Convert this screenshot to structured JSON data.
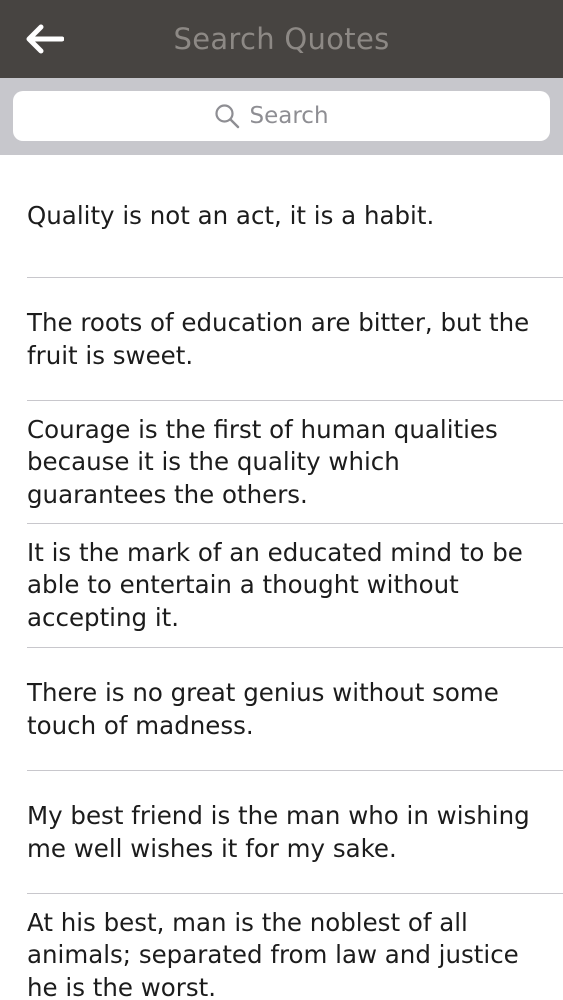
{
  "header": {
    "title": "Search Quotes",
    "back_icon": "arrow-left-icon"
  },
  "search": {
    "placeholder": "Search",
    "value": "",
    "icon": "search-icon"
  },
  "quotes": [
    "Quality is not an act, it is a habit.",
    "The roots of education are bitter, but the fruit is sweet.",
    "Courage is the first of human qualities because it is the quality which guarantees the others.",
    "It is the mark of an educated mind to be able to entertain a thought without accepting it.",
    "There is no great genius without some touch of madness.",
    "My best friend is the man who in wishing me well wishes it for my sake.",
    "At his best, man is the noblest of all animals; separated from law and justice he is the worst."
  ],
  "colors": {
    "navbar": "#474441",
    "title": "#8d8985",
    "search_bar_bg": "#c7c7cc",
    "divider": "#c8c7cc"
  }
}
